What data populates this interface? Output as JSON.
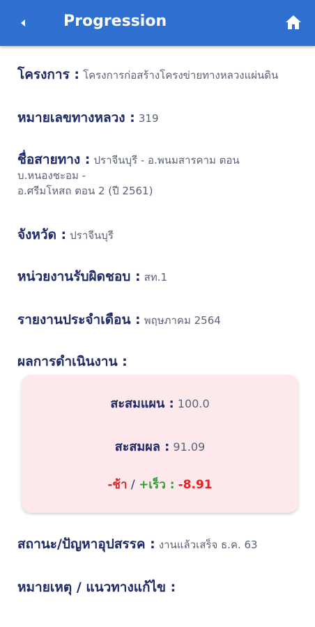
{
  "header": {
    "title": "Progression",
    "back_icon": "chevron-left-icon",
    "home_icon": "home-icon",
    "bg_color": "#2f6fd0"
  },
  "fields": {
    "project": {
      "label": "โครงการ :",
      "value": "โครงการก่อสร้างโครงข่ายทางหลวงแผ่นดิน"
    },
    "highway_no": {
      "label": "หมายเลขทางหลวง :",
      "value": "319"
    },
    "route": {
      "label": "ชื่อสายทาง :",
      "line1": "ปราจีนบุรี - อ.พนมสารคาม ตอน",
      "line2": "บ.หนองชะอม -",
      "line3": "อ.ศรีมโหสถ ตอน 2 (ปี 2561)"
    },
    "province": {
      "label": "จังหวัด :",
      "value": "ปราจีนบุรี"
    },
    "agency": {
      "label": "หน่วยงานรับผิดชอบ :",
      "value": "สท.1"
    },
    "monthly_report": {
      "label": "รายงานประจำเดือน :",
      "value": "พฤษภาคม 2564"
    },
    "performance": {
      "label": "ผลการดำเนินงาน :"
    },
    "status": {
      "label": "สถานะ/ปัญหาอุปสรรค :",
      "value": "งานแล้วเสร็จ ธ.ค. 63"
    },
    "remarks": {
      "label": "หมายเหตุ / แนวทางแก้ไข :"
    }
  },
  "performance_card": {
    "plan_label": "สะสมแผน :",
    "plan_value": "100.0",
    "result_label": "สะสมผล :",
    "result_value": "91.09",
    "slow_label": "-ช้า",
    "separator": " / ",
    "fast_label": "+เร็ว :",
    "diff_value": "-8.91",
    "bg_color": "#fde9ec"
  }
}
